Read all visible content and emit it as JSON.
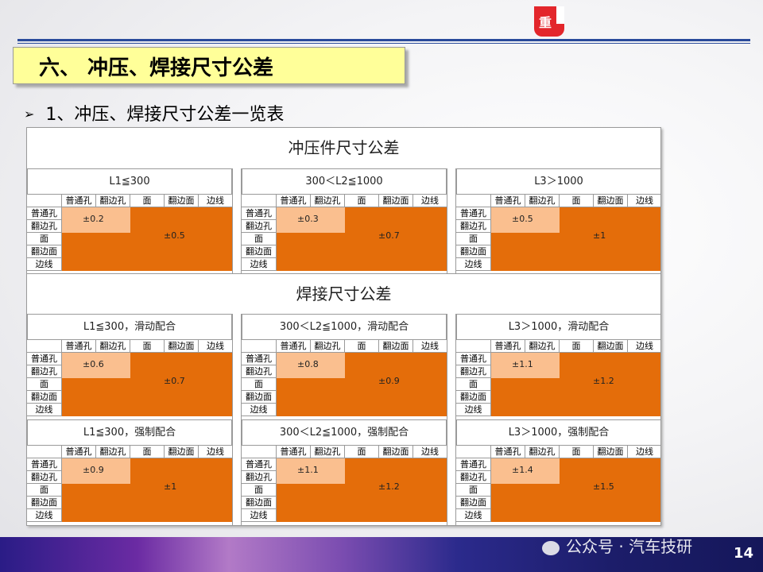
{
  "logo": {
    "glyph": "重"
  },
  "title": "六、 冲压、焊接尺寸公差",
  "subtitle": "1、冲压、焊接尺寸公差一览表",
  "col_headers": [
    "普通孔",
    "翻边孔",
    "面",
    "翻边面",
    "边线"
  ],
  "row_headers": [
    "普通孔",
    "翻边孔",
    "面",
    "翻边面",
    "边线"
  ],
  "sections": [
    {
      "title": "冲压件尺寸公差",
      "blocks": [
        {
          "header": "L1≦300",
          "hole_tol": "±0.2",
          "surface_tol": "±0.5"
        },
        {
          "header": "300＜L2≦1000",
          "hole_tol": "±0.3",
          "surface_tol": "±0.7"
        },
        {
          "header": "L3＞1000",
          "hole_tol": "±0.5",
          "surface_tol": "±1"
        }
      ]
    },
    {
      "title": "焊接尺寸公差",
      "rows": [
        [
          {
            "header": "L1≦300，滑动配合",
            "hole_tol": "±0.6",
            "surface_tol": "±0.7"
          },
          {
            "header": "300＜L2≦1000，滑动配合",
            "hole_tol": "±0.8",
            "surface_tol": "±0.9"
          },
          {
            "header": "L3＞1000，滑动配合",
            "hole_tol": "±1.1",
            "surface_tol": "±1.2"
          }
        ],
        [
          {
            "header": "L1≦300，强制配合",
            "hole_tol": "±0.9",
            "surface_tol": "±1"
          },
          {
            "header": "300＜L2≦1000，强制配合",
            "hole_tol": "±1.1",
            "surface_tol": "±1.2"
          },
          {
            "header": "L3＞1000，强制配合",
            "hole_tol": "±1.4",
            "surface_tol": "±1.5"
          }
        ]
      ]
    }
  ],
  "watermark": "公众号 · 汽车技研",
  "page_number": "14",
  "colors": {
    "orange": "#e46d0a",
    "peach": "#fabf8f",
    "title_bg": "#ffff99",
    "rule": "#2a4b9b"
  }
}
